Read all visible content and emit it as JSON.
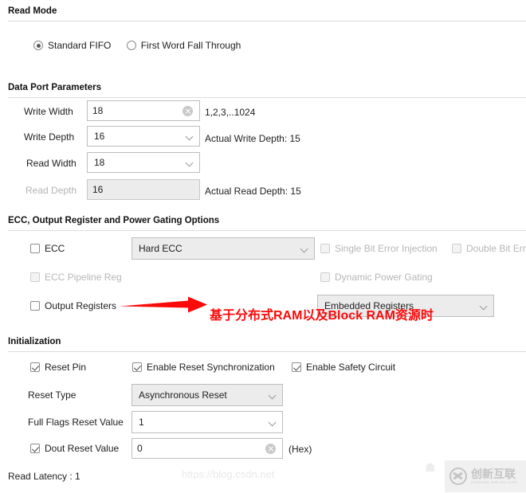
{
  "sections": {
    "read_mode": {
      "title": "Read Mode"
    },
    "data_port": {
      "title": "Data Port Parameters"
    },
    "ecc": {
      "title": "ECC, Output Register and Power Gating Options"
    },
    "init": {
      "title": "Initialization"
    }
  },
  "read_mode": {
    "options": [
      {
        "label": "Standard FIFO",
        "selected": true
      },
      {
        "label": "First Word Fall Through",
        "selected": false
      }
    ]
  },
  "data_port": {
    "write_width": {
      "label": "Write Width",
      "value": "18",
      "hint": "1,2,3,..1024",
      "clear_icon": "clear-circle-icon"
    },
    "write_depth": {
      "label": "Write Depth",
      "value": "16",
      "hint": "Actual Write Depth: 15",
      "chevron": "chevron-down-icon"
    },
    "read_width": {
      "label": "Read Width",
      "value": "18",
      "hint": "",
      "chevron": "chevron-down-icon"
    },
    "read_depth": {
      "label": "Read Depth",
      "value": "16",
      "hint": "Actual Read Depth: 15",
      "disabled": true
    }
  },
  "ecc": {
    "ecc_check": {
      "label": "ECC",
      "checked": false,
      "disabled": false
    },
    "ecc_mode": {
      "value": "Hard ECC",
      "chevron": "chevron-down-icon"
    },
    "single_bit": {
      "label": "Single Bit Error Injection",
      "checked": false,
      "disabled": true
    },
    "double_bit": {
      "label": "Double Bit Err",
      "checked": false,
      "disabled": true
    },
    "ecc_pipeline": {
      "label": "ECC Pipeline Reg",
      "checked": false,
      "disabled": true
    },
    "dynamic_power": {
      "label": "Dynamic Power Gating",
      "checked": false,
      "disabled": true
    },
    "output_registers": {
      "label": "Output Registers",
      "checked": false,
      "disabled": false
    },
    "register_type": {
      "value": "Embedded Registers",
      "chevron": "chevron-down-icon"
    }
  },
  "initialization": {
    "reset_pin": {
      "label": "Reset Pin",
      "checked": true
    },
    "enable_reset_sync": {
      "label": "Enable Reset Synchronization",
      "checked": true
    },
    "enable_safety": {
      "label": "Enable Safety Circuit",
      "checked": true
    },
    "reset_type": {
      "label": "Reset Type",
      "value": "Asynchronous Reset",
      "chevron": "chevron-down-icon"
    },
    "full_flags": {
      "label": "Full Flags Reset Value",
      "value": "1",
      "chevron": "chevron-down-icon"
    },
    "dout_reset": {
      "label": "Dout Reset Value",
      "value": "0",
      "suffix": "(Hex)",
      "checked": true,
      "clear_icon": "clear-circle-icon"
    }
  },
  "footer": {
    "read_latency": "Read Latency : 1"
  },
  "annotation": {
    "text": "基于分布式RAM以及Block RAM资源时",
    "color": "#fb0a0a",
    "arrow": "red-arrow-icon"
  },
  "watermark": {
    "url": "https://blog.csdn.net",
    "badge_cn": "创新互联",
    "badge_pinyin": "CHUANG XIN HU LIAN",
    "badge_mark": "x-circle-logo-icon"
  }
}
